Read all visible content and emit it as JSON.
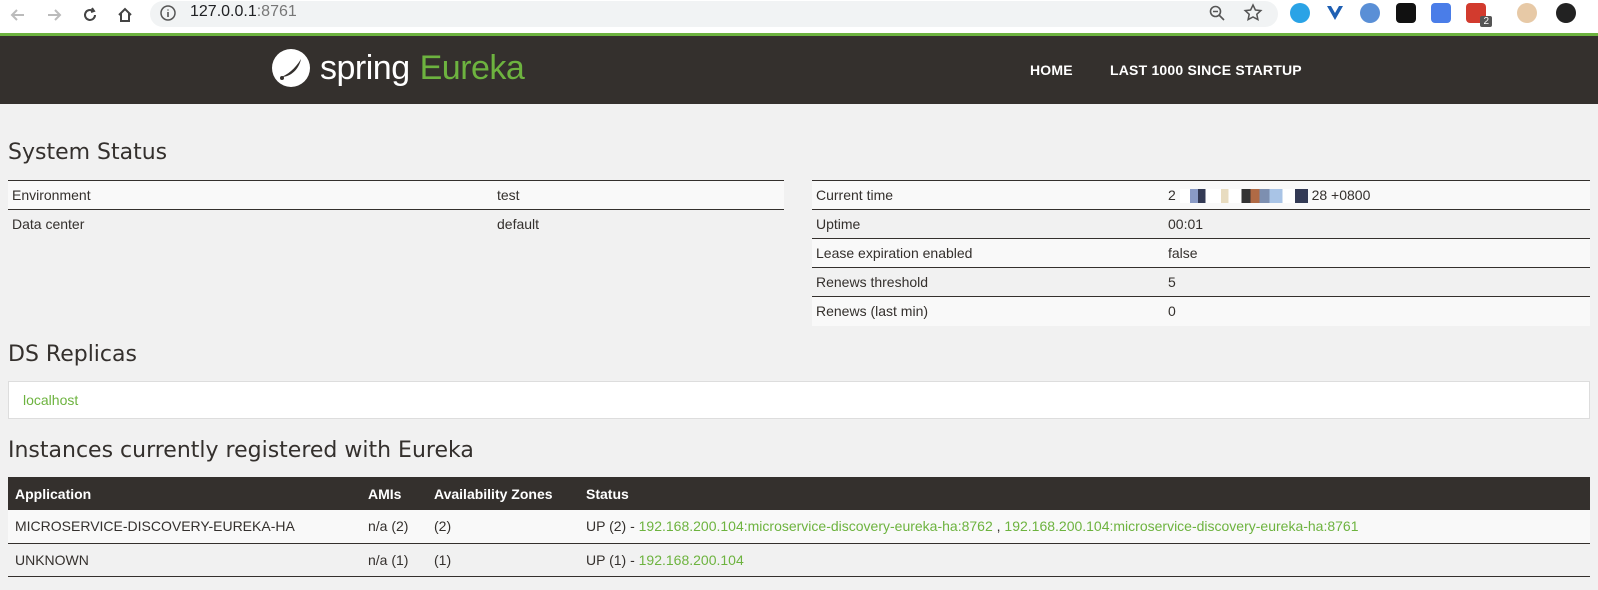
{
  "browser": {
    "url_host": "127.0.0.1",
    "url_port": ":8761",
    "extension_badge": "2"
  },
  "header": {
    "logo_spring": "spring",
    "logo_eureka": "Eureka",
    "nav_home": "HOME",
    "nav_last1000": "LAST 1000 SINCE STARTUP"
  },
  "system_status": {
    "title": "System Status",
    "left": [
      {
        "label": "Environment",
        "value": "test"
      },
      {
        "label": "Data center",
        "value": "default"
      }
    ],
    "right": [
      {
        "label": "Current time",
        "value_prefix": "2",
        "value_suffix": "28 +0800"
      },
      {
        "label": "Uptime",
        "value": "00:01"
      },
      {
        "label": "Lease expiration enabled",
        "value": "false"
      },
      {
        "label": "Renews threshold",
        "value": "5"
      },
      {
        "label": "Renews (last min)",
        "value": "0"
      }
    ]
  },
  "replicas": {
    "title": "DS Replicas",
    "items": [
      "localhost"
    ]
  },
  "instances": {
    "title": "Instances currently registered with Eureka",
    "columns": [
      "Application",
      "AMIs",
      "Availability Zones",
      "Status"
    ],
    "rows": [
      {
        "application": "MICROSERVICE-DISCOVERY-EUREKA-HA",
        "amis": "n/a (2)",
        "zones": "(2)",
        "status_prefix": "UP (2) - ",
        "link1": "192.168.200.104:microservice-discovery-eureka-ha:8762",
        "separator": " , ",
        "link2": "192.168.200.104:microservice-discovery-eureka-ha:8761"
      },
      {
        "application": "UNKNOWN",
        "amis": "n/a (1)",
        "zones": "(1)",
        "status_prefix": "UP (1) - ",
        "link1": "192.168.200.104"
      }
    ]
  },
  "colors": {
    "accent": "#6db33f",
    "header_bg": "#34302d",
    "page_bg": "#f1f1f1"
  }
}
